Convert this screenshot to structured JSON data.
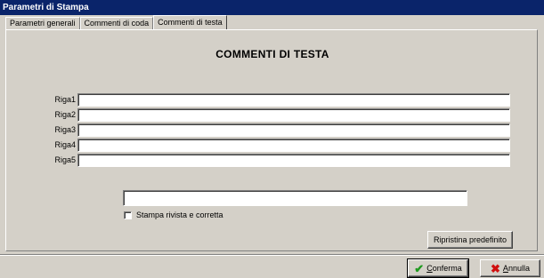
{
  "window": {
    "title": "Parametri di Stampa"
  },
  "tabs": [
    {
      "label": "Parametri generali",
      "active": false
    },
    {
      "label": "Commenti di coda",
      "active": false
    },
    {
      "label": "Commenti di testa",
      "active": true
    }
  ],
  "panel": {
    "heading": "COMMENTI DI TESTA",
    "rows": [
      {
        "label": "Riga1",
        "value": ""
      },
      {
        "label": "Riga2",
        "value": ""
      },
      {
        "label": "Riga3",
        "value": ""
      },
      {
        "label": "Riga4",
        "value": ""
      },
      {
        "label": "Riga5",
        "value": ""
      }
    ],
    "extra_field": {
      "value": ""
    },
    "checkbox": {
      "label": "Stampa rivista e corretta",
      "checked": false
    },
    "reset_button": {
      "label": "Ripristina predefinito"
    }
  },
  "footer": {
    "confirm": {
      "mnemonic": "C",
      "rest": "onferma",
      "icon": "check-icon"
    },
    "cancel": {
      "mnemonic": "A",
      "rest": "nnulla",
      "icon": "x-icon"
    }
  },
  "colors": {
    "titlebar": "#0a246a",
    "face": "#d4d0c8",
    "confirm_icon": "#1f9a1f",
    "cancel_icon": "#d01010"
  }
}
